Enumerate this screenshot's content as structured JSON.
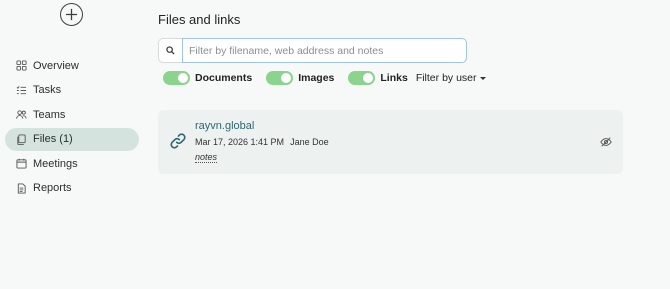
{
  "sidebar": {
    "add_icon": "plus-circle-icon",
    "items": [
      {
        "label": "Overview",
        "icon": "grid-icon"
      },
      {
        "label": "Tasks",
        "icon": "checklist-icon"
      },
      {
        "label": "Teams",
        "icon": "people-icon"
      },
      {
        "label": "Files (1)",
        "icon": "files-icon",
        "active": true
      },
      {
        "label": "Meetings",
        "icon": "calendar-icon"
      },
      {
        "label": "Reports",
        "icon": "document-icon"
      }
    ]
  },
  "main": {
    "title": "Files and links",
    "search": {
      "placeholder": "Filter by filename, web address and notes",
      "value": "",
      "icon": "search-icon"
    },
    "filters": {
      "toggles": [
        {
          "label": "Documents",
          "on": true
        },
        {
          "label": "Images",
          "on": true
        },
        {
          "label": "Links",
          "on": true
        }
      ],
      "filter_by_user": "Filter by user"
    },
    "files": [
      {
        "icon": "link-icon",
        "name": "rayvn.global",
        "date": "Mar 17, 2026 1:41 PM",
        "author": "Jane Doe",
        "notes": "notes",
        "action_icon": "eye-off-icon"
      }
    ]
  },
  "colors": {
    "toggle_on": "#8ad48e",
    "active_nav": "#d5e3df",
    "link_text": "#2f6672",
    "focus_border": "#9ec4ea"
  }
}
